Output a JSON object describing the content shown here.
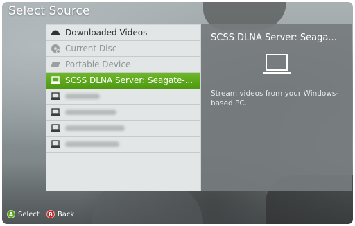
{
  "title": "Select Source",
  "sources": [
    {
      "label": "Downloaded Videos",
      "icon": "downloads-icon",
      "state": "normal"
    },
    {
      "label": "Current Disc",
      "icon": "disc-icon",
      "state": "disabled"
    },
    {
      "label": "Portable Device",
      "icon": "portable-device-icon",
      "state": "disabled"
    },
    {
      "label": "SCSS DLNA Server: Seagate-...",
      "icon": "laptop-icon",
      "state": "selected"
    },
    {
      "label": "",
      "icon": "laptop-icon",
      "state": "blurred"
    },
    {
      "label": "",
      "icon": "laptop-icon",
      "state": "blurred"
    },
    {
      "label": "",
      "icon": "laptop-icon",
      "state": "blurred"
    },
    {
      "label": "",
      "icon": "laptop-icon",
      "state": "blurred"
    }
  ],
  "detail": {
    "title": "SCSS DLNA Server: Seaga...",
    "description": "Stream videos from your Windows-based PC.",
    "icon": "laptop-icon"
  },
  "footer": {
    "a_glyph": "A",
    "a_label": "Select",
    "b_glyph": "B",
    "b_label": "Back"
  },
  "colors": {
    "selected": "#5aa51e",
    "a_button": "#5aa51e",
    "b_button": "#c82424"
  }
}
